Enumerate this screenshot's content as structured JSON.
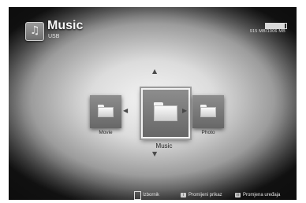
{
  "header": {
    "title": "Music",
    "subtitle": "USB",
    "storage": {
      "text": "915 MB/1006 MB",
      "used_fraction": 0.91
    }
  },
  "icons": {
    "header": "music-note-icon",
    "folder": "folder-icon"
  },
  "menu": {
    "items": [
      {
        "label": "Movie"
      },
      {
        "label": "Music",
        "selected": true
      },
      {
        "label": "Photo"
      }
    ]
  },
  "footer": {
    "items": [
      {
        "key_icon": "document-icon",
        "label": "Izbornik"
      },
      {
        "key_icon": "info-key-icon",
        "key_text": "i",
        "label": "Promijeni prikaz"
      },
      {
        "key_icon": "input-key-icon",
        "key_text": "⊟",
        "label": "Promjena uređaja"
      }
    ]
  }
}
